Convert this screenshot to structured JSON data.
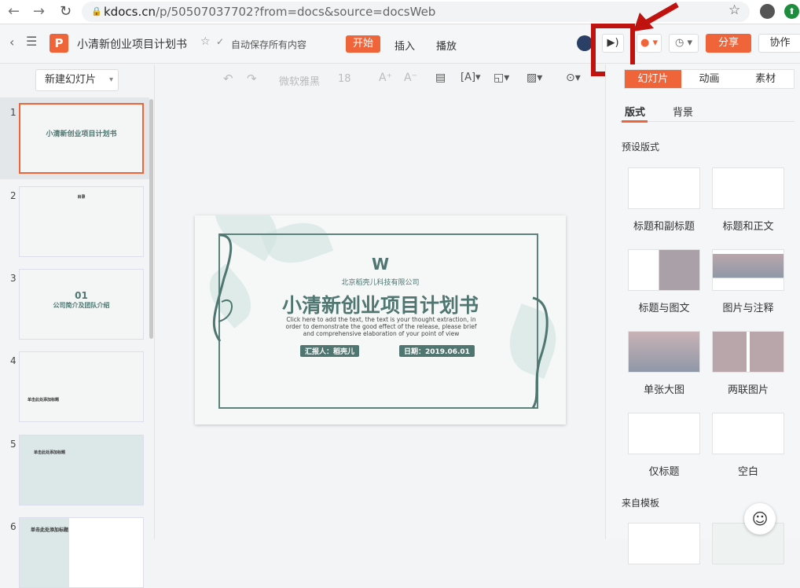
{
  "browser": {
    "url_host": "kdocs.cn",
    "url_path": "/p/50507037702?from=docs&source=docsWeb"
  },
  "header": {
    "doc_title": "小清新创业项目计划书",
    "save_status": "自动保存所有内容",
    "tabs": [
      "开始",
      "插入",
      "播放"
    ],
    "share": "分享",
    "collab": "协作"
  },
  "left": {
    "new_slide": "新建幻灯片",
    "slides": [
      {
        "num": "1",
        "title": "小清新创业项目计划书"
      },
      {
        "num": "2",
        "title": "目录"
      },
      {
        "num": "3",
        "title": "公司简介及团队介绍",
        "big": "01"
      },
      {
        "num": "4",
        "title": "单击此处添加标题"
      },
      {
        "num": "5",
        "title": "单击此处添加标题"
      },
      {
        "num": "6",
        "title": "单击此处添加标题"
      }
    ]
  },
  "toolbar": {
    "font": "微软雅黑",
    "size": "18"
  },
  "slide": {
    "company": "北京稻壳儿科技有限公司",
    "title": "小清新创业项目计划书",
    "body": "Click here to add the text, the text is your thought extraction, in order to demonstrate the good effect of the release, please brief and comprehensive elaboration of your point of view",
    "reporter": "汇报人：稻壳儿",
    "date": "日期：2019.06.01"
  },
  "right": {
    "tabs": [
      "幻灯片",
      "动画",
      "素材"
    ],
    "subtabs": [
      "版式",
      "背景"
    ],
    "preset": "预设版式",
    "layouts": [
      "标题和副标题",
      "标题和正文",
      "标题与图文",
      "图片与注释",
      "单张大图",
      "两联图片",
      "仅标题",
      "空白"
    ],
    "from_template": "来自模板"
  },
  "colors": {
    "accent": "#f0643a",
    "slide_green": "#4f7670",
    "annotation": "#c0120f"
  }
}
